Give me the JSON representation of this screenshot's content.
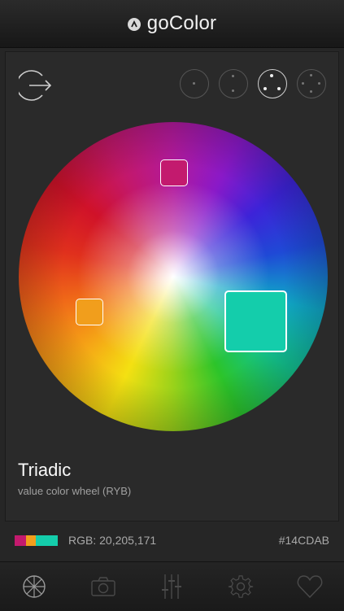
{
  "app": {
    "title": "goColor"
  },
  "modes": [
    {
      "name": "single",
      "active": false
    },
    {
      "name": "complementary",
      "active": false
    },
    {
      "name": "triadic",
      "active": true
    },
    {
      "name": "tetradic",
      "active": false
    }
  ],
  "scheme": {
    "name": "Triadic",
    "subtitle": "value color wheel (RYB)"
  },
  "swatches": [
    {
      "color": "#C31A6E",
      "selected": false
    },
    {
      "color": "#F19E1C",
      "selected": false
    },
    {
      "color": "#14CDAB",
      "selected": true
    }
  ],
  "selection": {
    "rgb_label": "RGB: 20,205,171",
    "hex": "#14CDAB"
  },
  "colors": {
    "background": "#262626",
    "panel": "#2a2a2a",
    "inactive_icon": "#555555",
    "tab_active": "#9a9a9a",
    "tab_inactive": "#4a4a4a"
  },
  "tabs": [
    {
      "name": "wheel",
      "icon": "color-wheel-icon",
      "active": true
    },
    {
      "name": "camera",
      "icon": "camera-icon",
      "active": false
    },
    {
      "name": "adjust",
      "icon": "sliders-icon",
      "active": false
    },
    {
      "name": "settings",
      "icon": "gear-icon",
      "active": false
    },
    {
      "name": "favorites",
      "icon": "heart-icon",
      "active": false
    }
  ]
}
